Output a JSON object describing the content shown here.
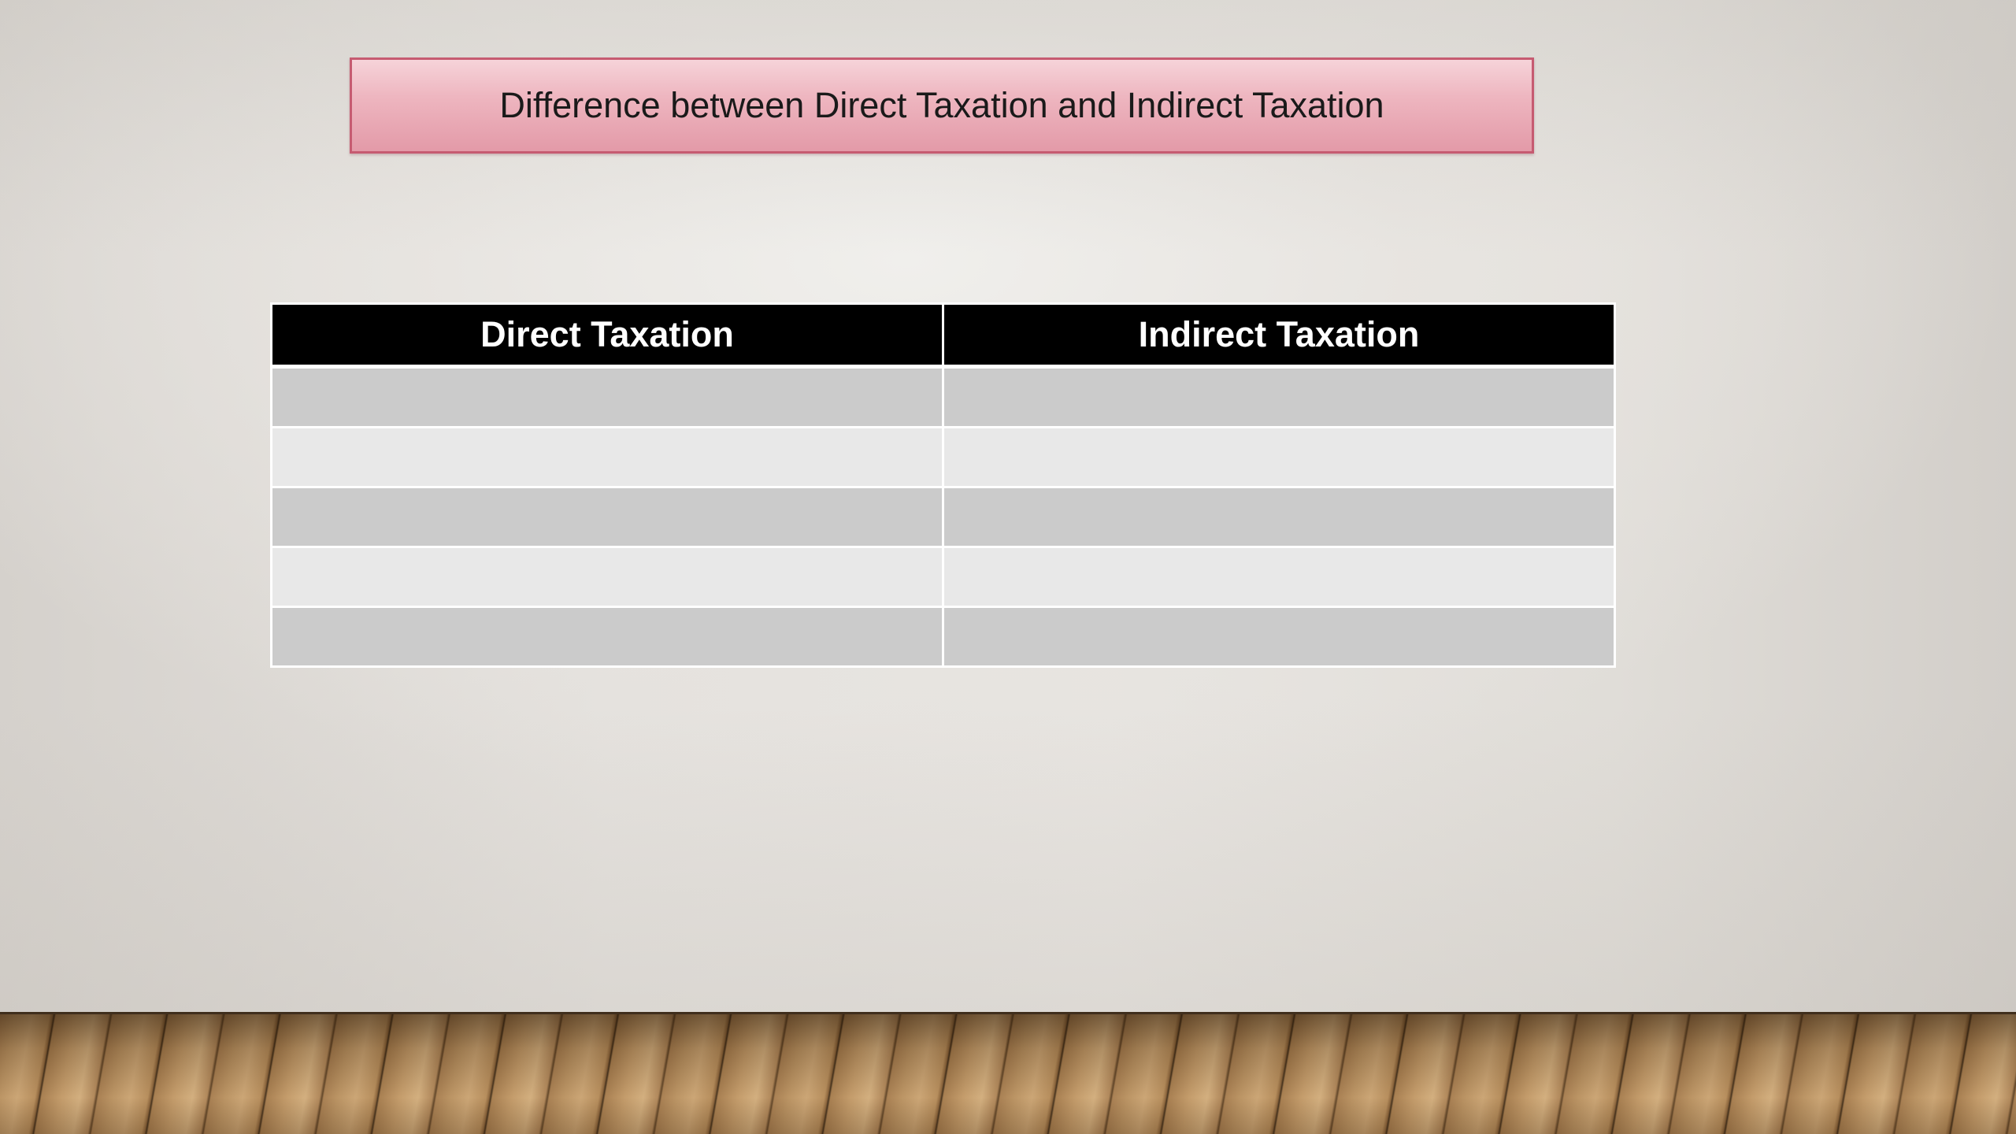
{
  "slide": {
    "title": "Difference between Direct Taxation and Indirect Taxation",
    "table": {
      "headers": [
        "Direct Taxation",
        "Indirect Taxation"
      ],
      "rows": [
        [
          "",
          ""
        ],
        [
          "",
          ""
        ],
        [
          "",
          ""
        ],
        [
          "",
          ""
        ],
        [
          "",
          ""
        ]
      ]
    },
    "colors": {
      "title_fill": "#eeb6c0",
      "title_border": "#c65b71",
      "header_fill": "#000000",
      "header_text": "#ffffff",
      "row_dark": "#cbcbcb",
      "row_light": "#e8e8e8",
      "wall": "#e6e3df",
      "floor": "#b08757"
    }
  }
}
